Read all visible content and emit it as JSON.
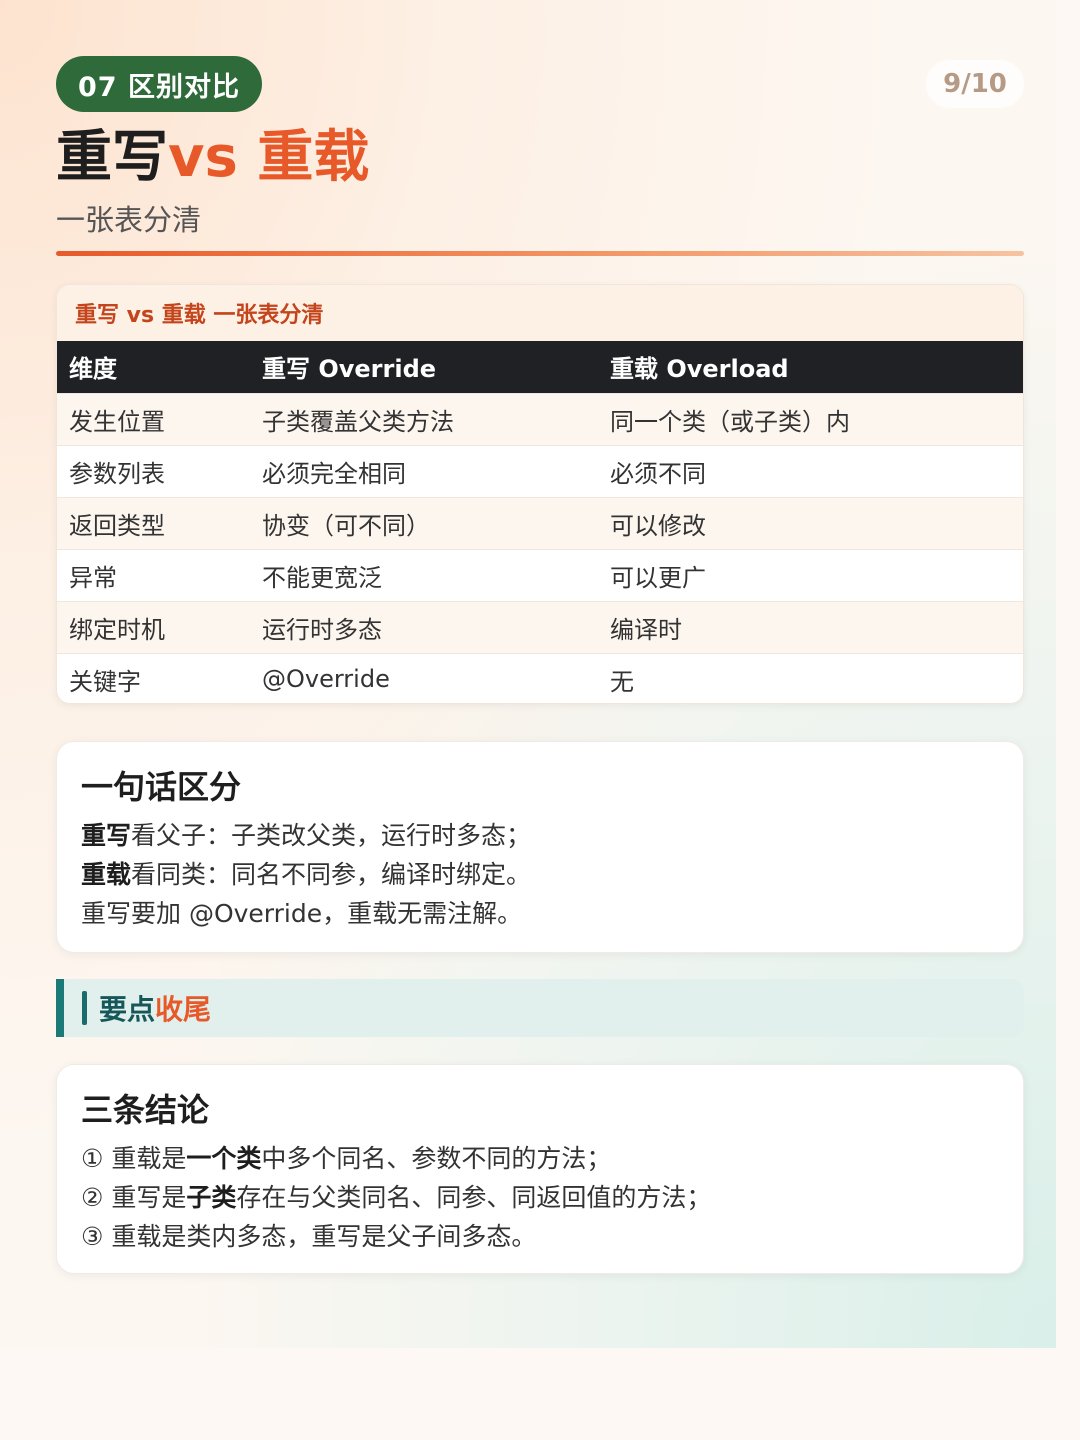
{
  "header": {
    "chapter": "07 区别对比",
    "page_indicator": "9/10",
    "title_part1": "重写",
    "title_part2": "vs 重载",
    "subtitle": "一张表分清"
  },
  "table": {
    "caption": "重写 vs 重载 一张表分清",
    "headers": [
      "维度",
      "重写 Override",
      "重载 Overload"
    ],
    "rows": [
      [
        "发生位置",
        "子类覆盖父类方法",
        "同一个类（或子类）内"
      ],
      [
        "参数列表",
        "必须完全相同",
        "必须不同"
      ],
      [
        "返回类型",
        "协变（可不同）",
        "可以修改"
      ],
      [
        "异常",
        "不能更宽泛",
        "可以更广"
      ],
      [
        "绑定时机",
        "运行时多态",
        "编译时"
      ],
      [
        "关键字",
        "@Override",
        "无"
      ]
    ]
  },
  "summary_card": {
    "title": "一句话区分",
    "line1_bold": "重写",
    "line1_rest": "看父子：子类改父类，运行时多态；",
    "line2_bold": "重载",
    "line2_rest": "看同类：同名不同参，编译时绑定。",
    "line3": "重写要加 @Override，重载无需注解。"
  },
  "section": {
    "label_part1": "要点",
    "label_part2": "收尾"
  },
  "conclusion_card": {
    "title": "三条结论",
    "item1_pre": "① 重载是",
    "item1_bold": "一个类",
    "item1_post": "中多个同名、参数不同的方法；",
    "item2_pre": "② 重写是",
    "item2_bold": "子类",
    "item2_post": "存在与父类同名、同参、同返回值的方法；",
    "item3": "③ 重载是类内多态，重写是父子间多态。"
  },
  "colors": {
    "accent_orange": "#e8592a",
    "chapter_green": "#2f6b3a",
    "section_teal": "#1b7a78",
    "table_header_dark": "#1f2125"
  }
}
